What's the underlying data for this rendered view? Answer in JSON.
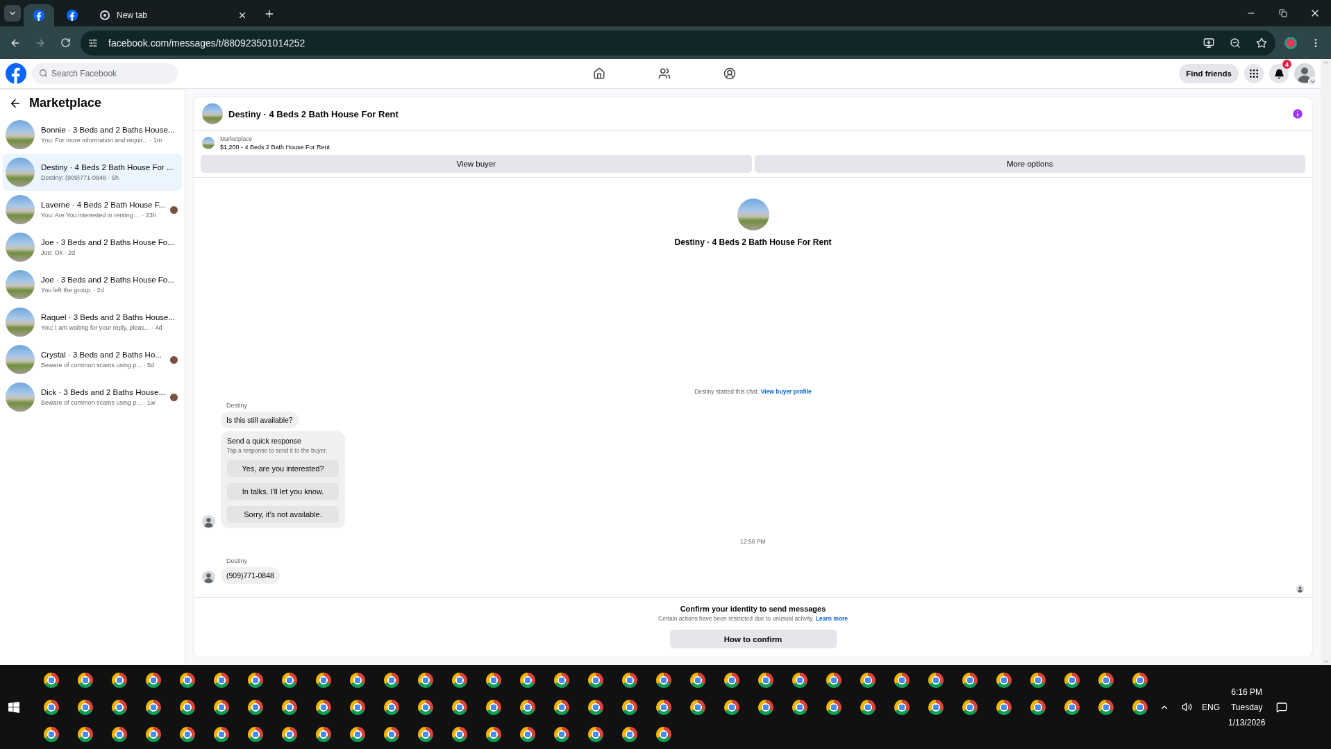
{
  "browser": {
    "tabs": [
      {
        "kind": "favicon",
        "selected": true
      },
      {
        "kind": "favicon",
        "selected": false
      },
      {
        "kind": "titled",
        "title": "New tab",
        "selected": false
      }
    ],
    "url": "facebook.com/messages/t/880923501014252"
  },
  "header": {
    "search": {
      "placeholder": "Search Facebook"
    },
    "find_friends": "Find friends",
    "notification_count": "4"
  },
  "sidebar": {
    "title": "Marketplace",
    "threads": [
      {
        "title": "Bonnie · 3 Beds and 2 Baths House...",
        "preview": "You: For more information and requir... · 1m",
        "selected": false,
        "read_receipt": false
      },
      {
        "title": "Destiny · 4 Beds 2 Bath House For ...",
        "preview": "Destiny: (909)771-0848 · 5h",
        "selected": true,
        "read_receipt": false
      },
      {
        "title": "Laverne · 4 Beds 2 Bath House F...",
        "preview": "You: Are You interested in renting ... · 23h",
        "selected": false,
        "read_receipt": true
      },
      {
        "title": "Joe · 3 Beds and 2 Baths House Fo...",
        "preview": "Joe: Ok · 2d",
        "selected": false,
        "read_receipt": false
      },
      {
        "title": "Joe · 3 Beds and 2 Baths House Fo...",
        "preview": "You left the group. · 2d",
        "selected": false,
        "read_receipt": false
      },
      {
        "title": "Raquel · 3 Beds and 2 Baths House...",
        "preview": "You: I am waiting for your reply, pleas... · 4d",
        "selected": false,
        "read_receipt": false
      },
      {
        "title": "Crystal · 3 Beds and 2 Baths Ho...",
        "preview": "Beware of common scams using p... · 5d",
        "selected": false,
        "read_receipt": true
      },
      {
        "title": "Dick · 3 Beds and 2 Baths House...",
        "preview": "Beware of common scams using p... · 1w",
        "selected": false,
        "read_receipt": true
      }
    ]
  },
  "chat": {
    "title": "Destiny · 4 Beds 2 Bath House For Rent",
    "listing": {
      "label": "Marketplace",
      "summary": "$1,200 - 4 Beds 2 Bath House For Rent"
    },
    "actions": [
      "View buyer",
      "More options"
    ],
    "intro": {
      "title": "Destiny · 4 Beds 2 Bath House For Rent",
      "notice": "Destiny started this chat.",
      "link": "View buyer profile"
    },
    "thread": [
      {
        "kind": "group",
        "sender": "Destiny",
        "items": [
          {
            "kind": "bubble",
            "text": "Is this still available?"
          },
          {
            "kind": "quick",
            "title": "Send a quick response",
            "hint": "Tap a response to send it to the buyer.",
            "options": [
              "Yes, are you interested?",
              "In talks. I'll let you know.",
              "Sorry, it's not available."
            ]
          }
        ]
      },
      {
        "kind": "timestamp",
        "text": "12:56 PM"
      },
      {
        "kind": "group",
        "sender": "Destiny",
        "items": [
          {
            "kind": "bubble",
            "text": "(909)771-0848"
          }
        ]
      }
    ],
    "seen": true,
    "restriction": {
      "title": "Confirm your identity to send messages",
      "text": "Certain actions have been restricted due to unusual activity.",
      "link": "Learn more",
      "button": "How to confirm"
    }
  },
  "taskbar": {
    "language": "ENG",
    "time": "6:16 PM",
    "day": "Tuesday",
    "date": "1/13/2026"
  }
}
